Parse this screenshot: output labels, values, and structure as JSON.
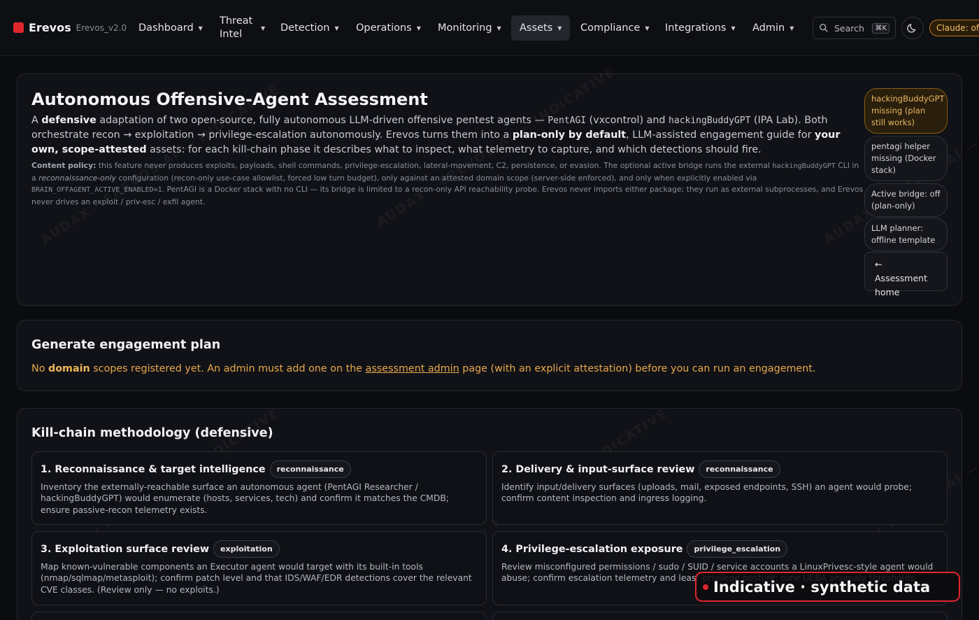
{
  "brand": {
    "name": "Erevos",
    "version": "Erevos_v2.0"
  },
  "nav": [
    {
      "label": "Dashboard"
    },
    {
      "label": "Threat Intel"
    },
    {
      "label": "Detection"
    },
    {
      "label": "Operations"
    },
    {
      "label": "Monitoring"
    },
    {
      "label": "Assets"
    },
    {
      "label": "Compliance"
    },
    {
      "label": "Integrations"
    },
    {
      "label": "Admin"
    }
  ],
  "search": {
    "label": "Search",
    "shortcut": "⌘K"
  },
  "claude_status": "Claude: offline",
  "hero": {
    "title": "Autonomous Offensive-Agent Assessment",
    "p1_a": "A ",
    "p1_b": "defensive",
    "p1_c": " adaptation of two open-source, fully autonomous LLM-driven offensive pentest agents — ",
    "p1_d": "PentAGI",
    "p1_e": " (vxcontrol) and ",
    "p1_f": "hackingBuddyGPT",
    "p1_g": " (IPA Lab). Both orchestrate recon → exploitation → privilege-escalation autonomously. Erevos turns them into a ",
    "p1_h": "plan-only by default",
    "p1_i": ", LLM-assisted engagement guide for ",
    "p1_j": "your own, scope-attested",
    "p1_k": " assets: for each kill-chain phase it describes what to inspect, what telemetry to capture, and which detections should fire.",
    "policy_label": "Content policy:",
    "policy_a": " this feature never produces exploits, payloads, shell commands, privilege-escalation, lateral-movement, C2, persistence, or evasion. The optional active bridge runs the external ",
    "policy_b": "hackingBuddyGPT",
    "policy_c": " CLI in a ",
    "policy_d": "reconnaissance-only",
    "policy_e": " configuration (recon-only use-case allowlist, forced low turn budget), only against an attested domain scope (server-side enforced), and only when explicitly enabled via ",
    "policy_f": "BRAIN_OFFAGENT_ACTIVE_ENABLED=1",
    "policy_g": ". PentAGI is a Docker stack with no CLI — its bridge is limited to a recon-only API reachability probe. Erevos never imports either package; they run as external subprocesses, and Erevos never drives an exploit / priv-esc / exfil agent."
  },
  "badges": {
    "hbgpt": "hackingBuddyGPT missing (plan still works)",
    "pentagi": "pentagi helper missing (Docker stack)",
    "bridge": "Active bridge: off (plan-only)",
    "planner": "LLM planner: offline template",
    "home": "← Assessment home"
  },
  "watermark": "AUDAX · EREVOS AI — INDICATIVE",
  "plan": {
    "title": "Generate engagement plan",
    "msg_a": "No ",
    "msg_b": "domain",
    "msg_c": " scopes registered yet. An admin must add one on the ",
    "msg_link": "assessment admin",
    "msg_d": " page (with an explicit attestation) before you can run an engagement."
  },
  "killchain": {
    "title": "Kill-chain methodology (defensive)",
    "phases": [
      {
        "name": "1. Reconnaissance & target intelligence",
        "tag": "reconnaissance",
        "desc": "Inventory the externally-reachable surface an autonomous agent (PentAGI Researcher / hackingBuddyGPT) would enumerate (hosts, services, tech) and confirm it matches the CMDB; ensure passive-recon telemetry exists."
      },
      {
        "name": "2. Delivery & input-surface review",
        "tag": "reconnaissance",
        "desc": "Identify input/delivery surfaces (uploads, mail, exposed endpoints, SSH) an agent would probe; confirm content inspection and ingress logging."
      },
      {
        "name": "3. Exploitation surface review",
        "tag": "exploitation",
        "desc": "Map known-vulnerable components an Executor agent would target with its built-in tools (nmap/sqlmap/metasploit); confirm patch level and that IDS/WAF/EDR detections cover the relevant CVE classes. (Review only — no exploits.)"
      },
      {
        "name": "4. Privilege-escalation exposure",
        "tag": "privilege_escalation",
        "desc": "Review misconfigured permissions / sudo / SUID / service accounts a LinuxPrivesc-style agent would abuse; confirm escalation telemetry and least-privilege posture; tune UEBA anomaly thresholds."
      }
    ]
  },
  "indicative": "Indicative · synthetic data"
}
